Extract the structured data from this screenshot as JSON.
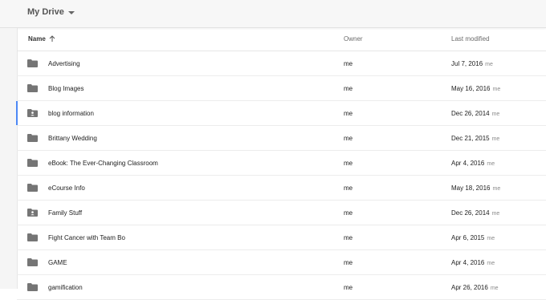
{
  "topbar": {
    "title": "My Drive"
  },
  "header": {
    "name": "Name",
    "owner": "Owner",
    "modified": "Last modified"
  },
  "colors": {
    "folder": "#757575",
    "accent": "#4d88f5"
  },
  "rows": [
    {
      "name": "Advertising",
      "owner": "me",
      "date": "Jul 7, 2016",
      "by": "me",
      "icon": "folder-icon"
    },
    {
      "name": "Blog Images",
      "owner": "me",
      "date": "May 16, 2016",
      "by": "me",
      "icon": "folder-icon"
    },
    {
      "name": "blog information",
      "owner": "me",
      "date": "Dec 26, 2014",
      "by": "me",
      "icon": "shared-folder-icon"
    },
    {
      "name": "Brittany Wedding",
      "owner": "me",
      "date": "Dec 21, 2015",
      "by": "me",
      "icon": "folder-icon"
    },
    {
      "name": "eBook: The Ever-Changing Classroom",
      "owner": "me",
      "date": "Apr 4, 2016",
      "by": "me",
      "icon": "folder-icon"
    },
    {
      "name": "eCourse Info",
      "owner": "me",
      "date": "May 18, 2016",
      "by": "me",
      "icon": "folder-icon"
    },
    {
      "name": "Family Stuff",
      "owner": "me",
      "date": "Dec 26, 2014",
      "by": "me",
      "icon": "shared-folder-icon"
    },
    {
      "name": "Fight Cancer with Team Bo",
      "owner": "me",
      "date": "Apr 6, 2015",
      "by": "me",
      "icon": "folder-icon"
    },
    {
      "name": "GAME",
      "owner": "me",
      "date": "Apr 4, 2016",
      "by": "me",
      "icon": "folder-icon"
    },
    {
      "name": "gamification",
      "owner": "me",
      "date": "Apr 26, 2016",
      "by": "me",
      "icon": "folder-icon"
    }
  ]
}
